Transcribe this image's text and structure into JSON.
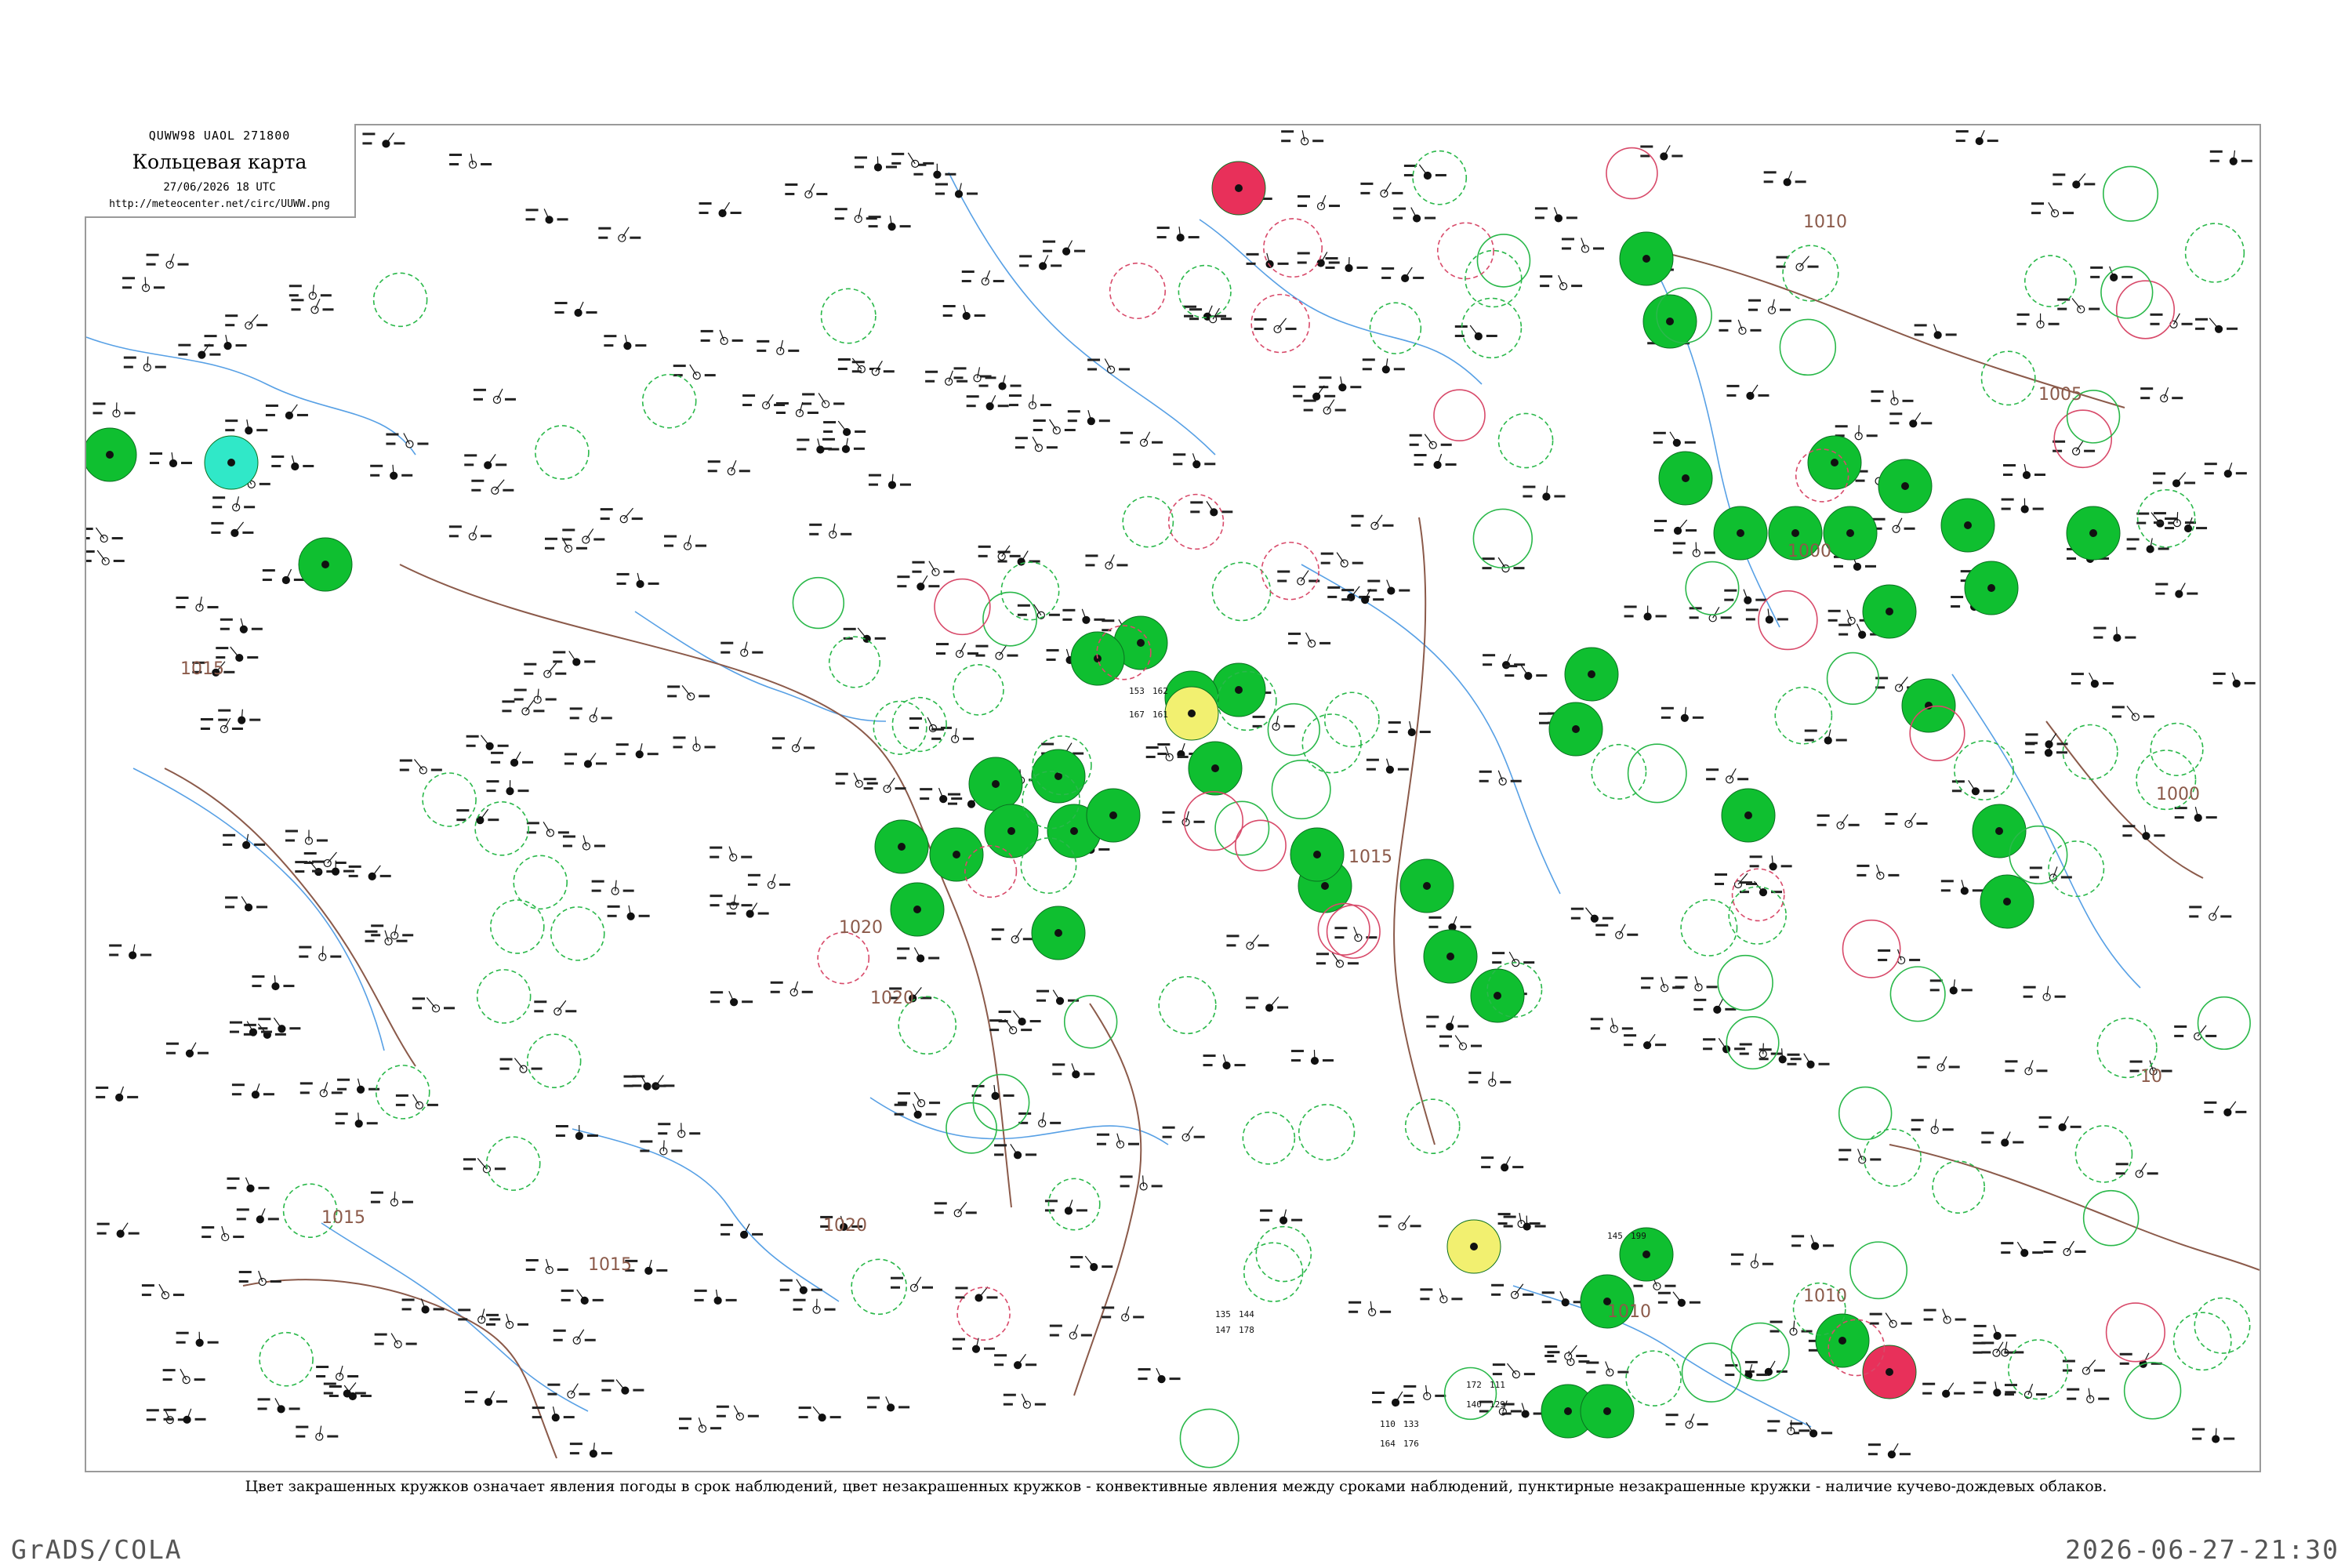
{
  "header": {
    "code": "QUWW98 UAOL 271800",
    "title": "Кольцевая карта",
    "time": "27/06/2026 18 UTC",
    "url": "http://meteocenter.net/circ/UUWW.png"
  },
  "caption": "Цвет закрашенных кружков означает явления погоды в срок наблюдений, цвет незакрашенных кружков - конвективные явления между сроками наблюдений, пунктирные незакрашенные кружки - наличие кучево-дождевых облаков.",
  "footer": {
    "left": "GrADS/COLA",
    "right": "2026-06-27-21:30"
  },
  "isobars": [
    "1010",
    "1005",
    "1000",
    "1000",
    "1015",
    "1015",
    "1020",
    "1020",
    "1020",
    "1010",
    "10",
    "1015",
    "1010",
    "1015"
  ],
  "station_numbers": [
    "153",
    "162",
    "167",
    "161",
    "172",
    "111",
    "140",
    "129",
    "135",
    "144",
    "147",
    "178",
    "110",
    "133",
    "164",
    "176",
    "145",
    "199"
  ],
  "colors": {
    "thunderstorm_fill": "#0fbf30",
    "squall_fill": "#e8305a",
    "fog_fill": "#f2f070",
    "showers_fill": "#30e8c8",
    "convective_ring_green": "#2ab84a",
    "convective_ring_red": "#d84a6a",
    "rivers": "#3a8fe0",
    "isobars": "#8b5a4a",
    "borders": "#c8a0a0"
  },
  "legend_icons": [
    "thunderstorm-icon",
    "squall-icon",
    "fog-icon",
    "rain-shower-icon"
  ]
}
